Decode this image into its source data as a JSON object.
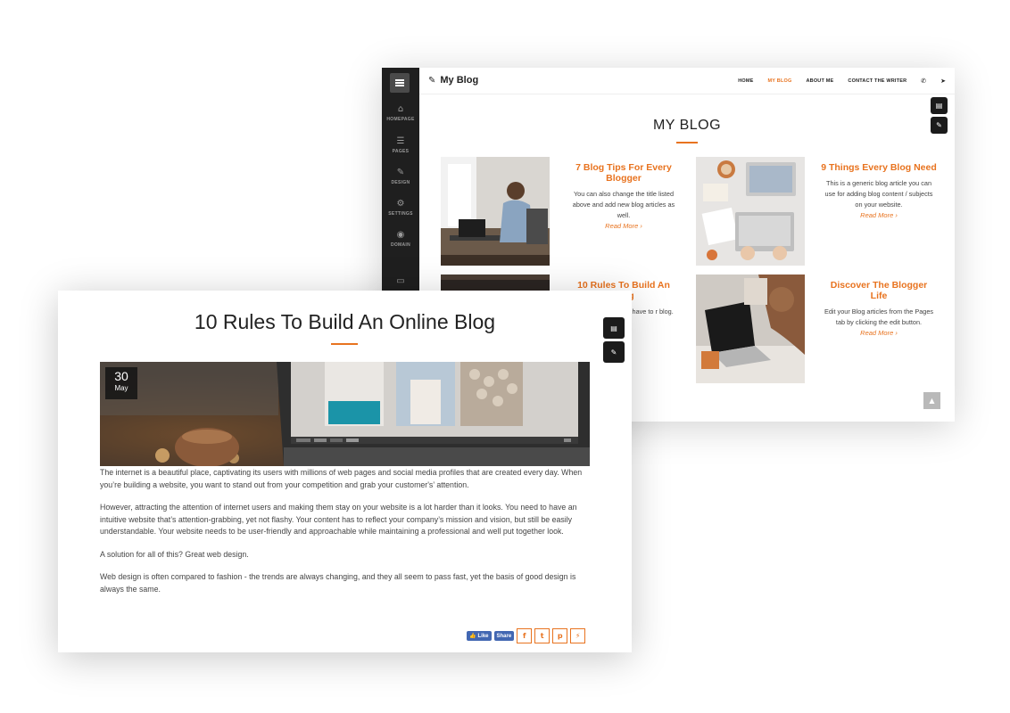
{
  "back": {
    "sidebar": [
      {
        "label": "HOMEPAGE",
        "icon": "home-icon"
      },
      {
        "label": "PAGES",
        "icon": "pages-icon"
      },
      {
        "label": "DESIGN",
        "icon": "brush-icon"
      },
      {
        "label": "SETTINGS",
        "icon": "gear-icon"
      },
      {
        "label": "DOMAIN",
        "icon": "globe-icon"
      }
    ],
    "brand": "My Blog",
    "nav": {
      "home": "HOME",
      "blog": "MY BLOG",
      "about": "ABOUT ME",
      "contact": "CONTACT THE WRITER"
    },
    "heading": "MY BLOG",
    "cards": [
      {
        "title": "7 Blog Tips For Every Blogger",
        "desc": "You can also change the title listed above and add new blog articles as well.",
        "more": "Read More ›"
      },
      {
        "title": "9 Things Every Blog Need",
        "desc": "This is a generic blog article you can use for adding blog content / subjects on your website.",
        "more": "Read More ›"
      },
      {
        "title": "10 Rules To Build An Blog",
        "desc": "this text and ng you have to r blog.",
        "more": "re ›"
      },
      {
        "title": "Discover The Blogger Life",
        "desc": "Edit your Blog articles from the Pages tab by clicking the edit button.",
        "more": "Read More ›"
      }
    ]
  },
  "front": {
    "title": "10 Rules To Build An Online Blog",
    "date_day": "30",
    "date_month": "May",
    "paragraphs": [
      "The internet is a beautiful place, captivating its users with millions of web pages and social media profiles that are created every day. When you’re building a website, you want to stand out from your competition and grab your customer's’ attention.",
      "However, attracting the attention of internet users and making them stay on your website is a lot harder than it looks. You need to have an intuitive website that’s attention-grabbing, yet not flashy. Your content has to reflect your company’s mission and vision, but still be easily understandable. Your website needs to be user-friendly and approachable while maintaining a professional and well put together look.",
      "A solution for all of this? Great web design.",
      "Web design is often compared to fashion - the trends are always changing, and they all seem to pass fast, yet the basis of good design is always the same."
    ],
    "like_label": "Like",
    "share_label": "Share"
  },
  "colors": {
    "accent": "#e8731f",
    "sidebar": "#1f1f1f",
    "facebook": "#4267b2"
  }
}
